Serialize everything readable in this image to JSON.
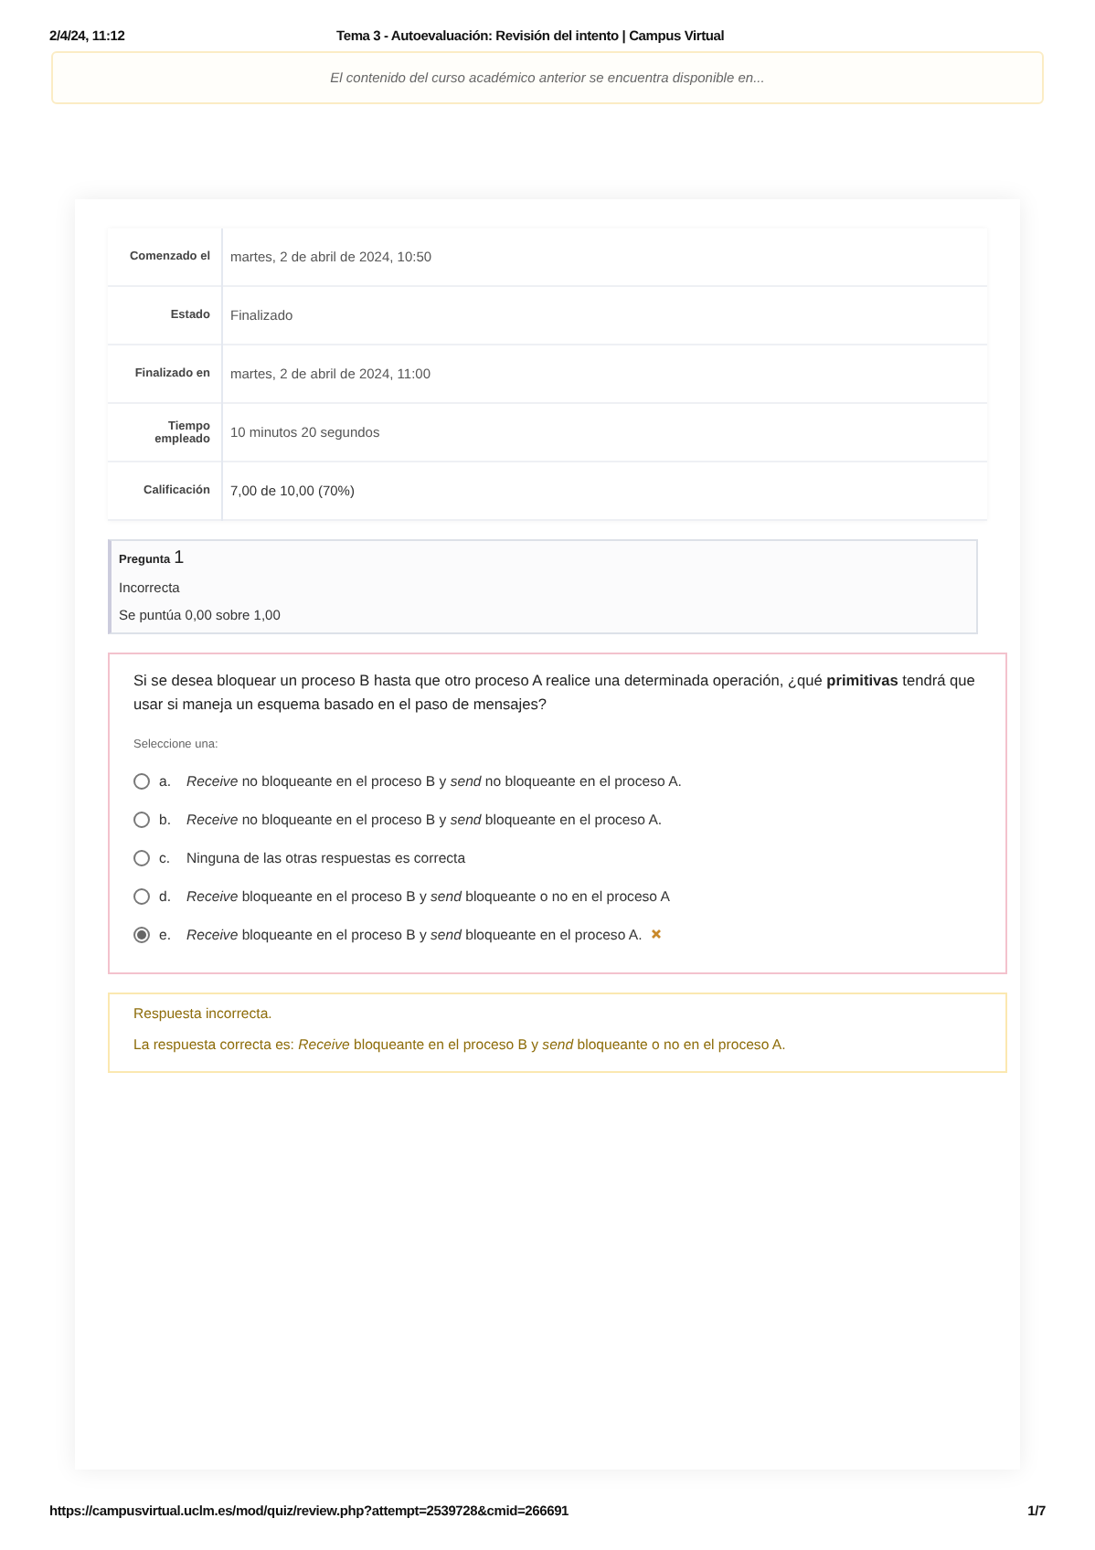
{
  "print_header": {
    "date": "2/4/24, 11:12",
    "title": "Tema 3 - Autoevaluación: Revisión del intento | Campus Virtual"
  },
  "notice": "El contenido del curso académico anterior se encuentra disponible en...",
  "summary": [
    {
      "label": "Comenzado el",
      "value": "martes, 2 de abril de 2024, 10:50"
    },
    {
      "label": "Estado",
      "value": "Finalizado"
    },
    {
      "label": "Finalizado en",
      "value": "martes, 2 de abril de 2024, 11:00"
    },
    {
      "label": "Tiempo empleado",
      "value": "10 minutos 20 segundos"
    },
    {
      "label": "Calificación",
      "value": "7,00 de 10,00 (70%)"
    }
  ],
  "question_info": {
    "label": "Pregunta",
    "number": "1",
    "state": "Incorrecta",
    "grade": "Se puntúa 0,00 sobre 1,00"
  },
  "question": {
    "text": "Si se desea bloquear un proceso B hasta que otro proceso A realice una determinada operación, ¿qué **primitivas** tendrá que usar si maneja un esquema basado en el paso de mensajes?",
    "prompt": "Seleccione una:",
    "options": [
      {
        "letter": "a.",
        "text": "*Receive* no bloqueante en el proceso B y *send* no bloqueante en el proceso A.",
        "selected": false,
        "marked_incorrect": false
      },
      {
        "letter": "b.",
        "text": "*Receive* no bloqueante en el proceso B y *send* bloqueante en el proceso A.",
        "selected": false,
        "marked_incorrect": false
      },
      {
        "letter": "c.",
        "text": "Ninguna de las otras respuestas es correcta",
        "selected": false,
        "marked_incorrect": false
      },
      {
        "letter": "d.",
        "text": "*Receive* bloqueante en el proceso B y *send* bloqueante o no en el proceso A",
        "selected": false,
        "marked_incorrect": false
      },
      {
        "letter": "e.",
        "text": "*Receive* bloqueante en el proceso B y *send* bloqueante en el proceso A.",
        "selected": true,
        "marked_incorrect": true
      }
    ]
  },
  "feedback": {
    "verdict": "Respuesta incorrecta.",
    "answer": "La respuesta correcta es: *Receive* bloqueante en el proceso B y *send* bloqueante o no en el proceso A."
  },
  "print_footer": {
    "url": "https://campusvirtual.uclm.es/mod/quiz/review.php?attempt=2539728&cmid=266691",
    "page": "1/7"
  }
}
